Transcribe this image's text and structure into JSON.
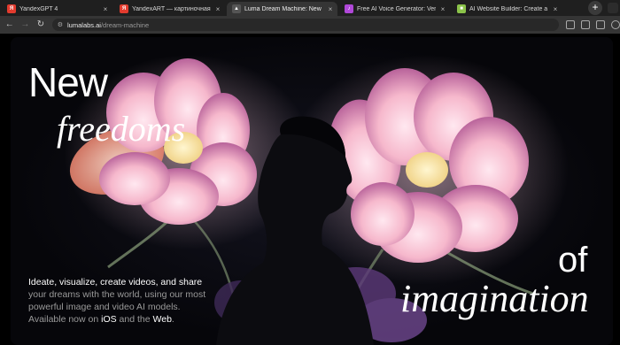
{
  "browser": {
    "tabs": [
      {
        "title": "YandexGPT 4",
        "favicon": "yandex-icon",
        "color": "#e33b2e",
        "active": false
      },
      {
        "title": "YandexART — картиночная нейр",
        "favicon": "yandex-icon",
        "color": "#e33b2e",
        "active": false
      },
      {
        "title": "Luma Dream Machine: New Free",
        "favicon": "luma-icon",
        "color": "#444444",
        "active": true
      },
      {
        "title": "Free AI Voice Generator: Versatile",
        "favicon": "voice-icon",
        "color": "#b048d8",
        "active": false
      },
      {
        "title": "AI Website Builder: Create a Web",
        "favicon": "builder-icon",
        "color": "#8bc34a",
        "active": false
      }
    ],
    "url_host": "lumalabs.ai",
    "url_path": "/dream-machine"
  },
  "hero": {
    "word_new": "New",
    "word_freedoms": "freedoms",
    "word_of": "of",
    "word_imagination": "imagination",
    "desc_lead": "Ideate, visualize, create videos, and share",
    "desc_line2": "your dreams with the world, using our most",
    "desc_line3": "powerful image and video AI models.",
    "desc_line4_a": "Available now on ",
    "desc_ios": "iOS",
    "desc_and": " and the ",
    "desc_web": "Web",
    "desc_period": "."
  }
}
